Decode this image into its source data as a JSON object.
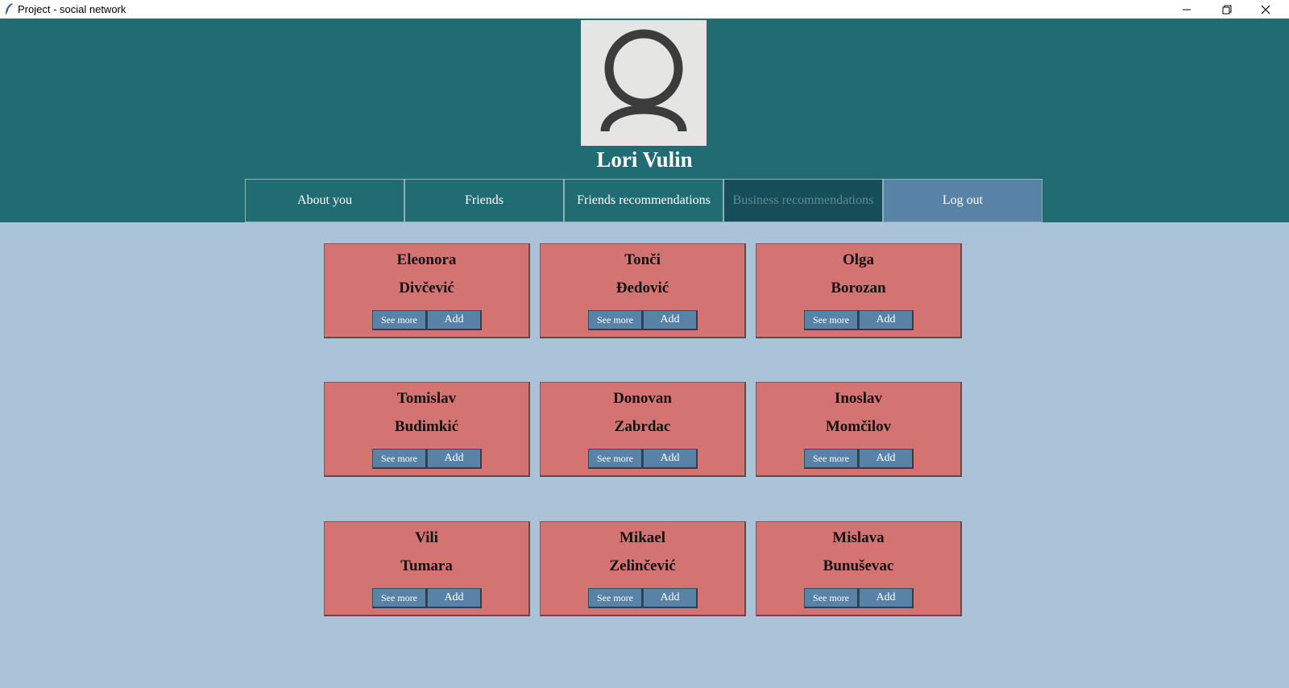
{
  "window": {
    "title": "Project - social network",
    "controls": {
      "minimize": "minimize-icon",
      "restore": "restore-icon",
      "close": "close-icon"
    }
  },
  "profile": {
    "name": "Lori Vulin",
    "avatar_icon": "user-avatar-icon"
  },
  "tabs": [
    {
      "label": "About you",
      "state": "normal"
    },
    {
      "label": "Friends",
      "state": "normal"
    },
    {
      "label": "Friends recommendations",
      "state": "normal"
    },
    {
      "label": "Business recommendations",
      "state": "disabled"
    },
    {
      "label": "Log out",
      "state": "highlight"
    }
  ],
  "cards": [
    {
      "first": "Eleonora",
      "last": "Divčević"
    },
    {
      "first": "Tonči",
      "last": "Đedović"
    },
    {
      "first": "Olga",
      "last": "Borozan"
    },
    {
      "first": "Tomislav",
      "last": "Budimkić"
    },
    {
      "first": "Donovan",
      "last": "Zabrdac"
    },
    {
      "first": "Inoslav",
      "last": "Momčilov"
    },
    {
      "first": "Vili",
      "last": "Tumara"
    },
    {
      "first": "Mikael",
      "last": "Zelinčević"
    },
    {
      "first": "Mislava",
      "last": "Bunuševac"
    }
  ],
  "card_buttons": {
    "see_more": "See more",
    "add": "Add"
  },
  "colors": {
    "header": "#216b72",
    "background": "#aac3d8",
    "card": "#d47472",
    "button": "#5882a6",
    "tab_disabled": "#154d58"
  }
}
